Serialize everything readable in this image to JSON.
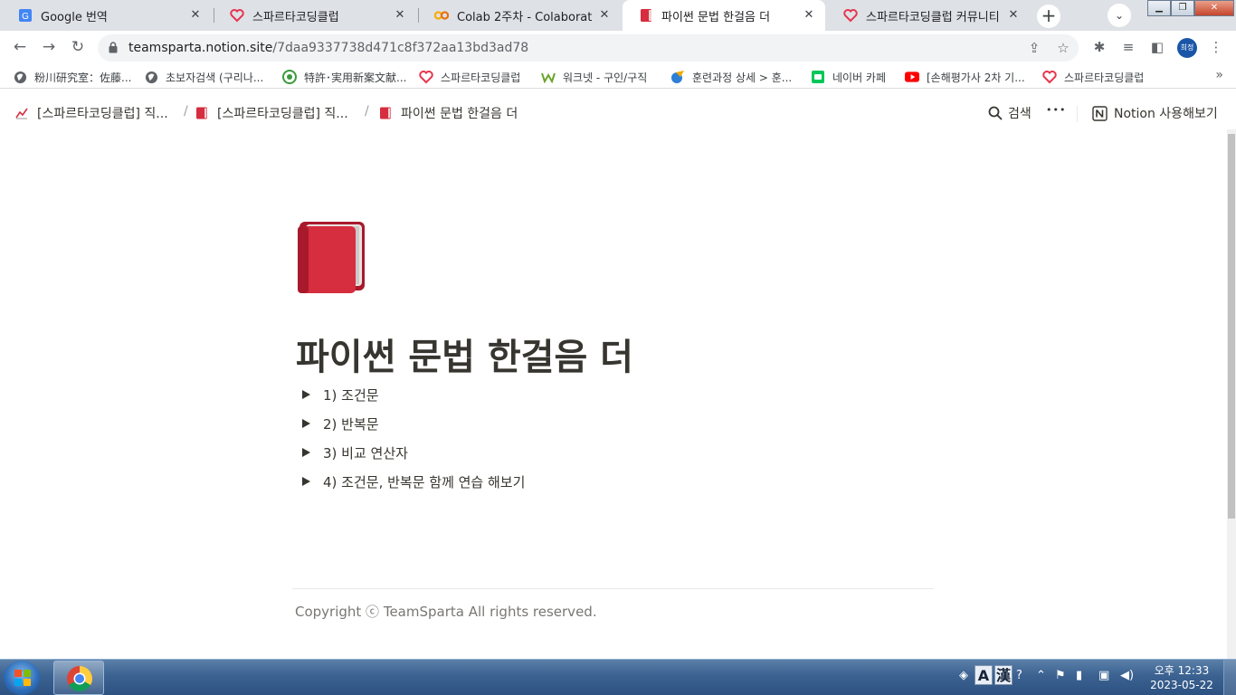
{
  "browser": {
    "tabs": [
      {
        "title": "Google 번역",
        "icon": "google-translate-icon",
        "active": false
      },
      {
        "title": "스파르타코딩클럽",
        "icon": "sparta-heart-icon",
        "active": false
      },
      {
        "title": "Colab 2주차 - Colaboratory",
        "icon": "colab-icon",
        "active": false
      },
      {
        "title": "파이썬 문법 한걸음 더",
        "icon": "red-book-icon",
        "active": true
      },
      {
        "title": "스파르타코딩클럽 커뮤니티 |",
        "icon": "sparta-heart-icon",
        "active": false
      }
    ],
    "url_host": "teamsparta.notion.site",
    "url_path": "/7daa9337738d471c8f372aa13bd3ad78",
    "profile_label": "희정",
    "bookmarks": [
      {
        "label": "粉川研究室：佐藤...",
        "icon": "globe-icon"
      },
      {
        "label": "초보자검색 (구리나...",
        "icon": "globe-icon"
      },
      {
        "label": "特許･実用新案文献...",
        "icon": "patent-icon"
      },
      {
        "label": "스파르타코딩클럽",
        "icon": "sparta-heart-icon"
      },
      {
        "label": "워크넷 - 구인/구직",
        "icon": "worknet-icon"
      },
      {
        "label": "훈련과정 상세 > 훈...",
        "icon": "training-icon"
      },
      {
        "label": "네이버 카페",
        "icon": "naver-cafe-icon"
      },
      {
        "label": "[손해평가사 2차 기...",
        "icon": "youtube-icon"
      },
      {
        "label": "스파르타코딩클럽",
        "icon": "sparta-heart-icon"
      }
    ],
    "bookmarks_more": "»"
  },
  "notion": {
    "breadcrumbs": [
      {
        "label": "[스파르타코딩클럽] 직...",
        "icon": "chart-icon"
      },
      {
        "label": "[스파르타코딩클럽] 직...",
        "icon": "red-book-icon"
      },
      {
        "label": "파이썬 문법 한걸음 더",
        "icon": "red-book-icon"
      }
    ],
    "breadcrumb_separator": "/",
    "search_label": "검색",
    "more_label": "•••",
    "try_notion_label": "Notion 사용해보기"
  },
  "page": {
    "title": "파이썬 문법 한걸음 더",
    "toggles": [
      "1) 조건문",
      "2) 반복문",
      "3) 비교 연산자",
      "4) 조건문, 반복문 함께 연습 해보기"
    ],
    "copyright": "Copyright ⓒ TeamSparta All rights reserved."
  },
  "taskbar": {
    "clock_time": "오후 12:33",
    "clock_date": "2023-05-22",
    "ime_labels": [
      "A",
      "漢"
    ]
  },
  "colors": {
    "notion_text": "#37352f",
    "chrome_tabstrip": "#dee1e6",
    "book_red": "#d62d3f"
  }
}
